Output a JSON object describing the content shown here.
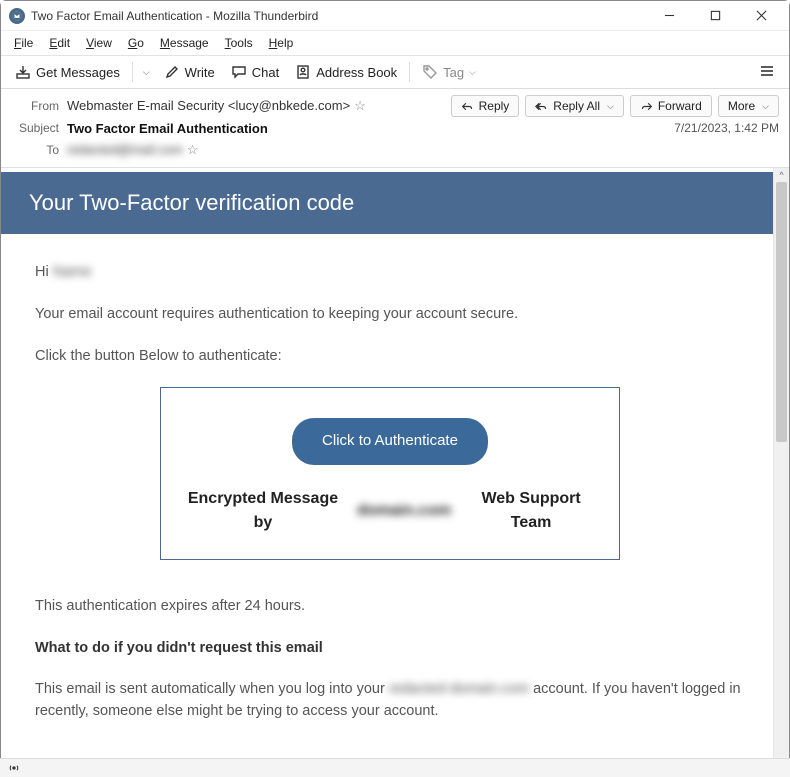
{
  "window": {
    "title": "Two Factor Email Authentication - Mozilla Thunderbird"
  },
  "menu": {
    "file": "File",
    "edit": "Edit",
    "view": "View",
    "go": "Go",
    "message": "Message",
    "tools": "Tools",
    "help": "Help"
  },
  "toolbar": {
    "get_messages": "Get Messages",
    "write": "Write",
    "chat": "Chat",
    "address_book": "Address Book",
    "tag": "Tag"
  },
  "header": {
    "from_label": "From",
    "from_value": "Webmaster E-mail Security <lucy@nbkede.com>",
    "subject_label": "Subject",
    "subject_value": "Two Factor Email Authentication",
    "to_label": "To",
    "to_value": "redacted@mail.com",
    "date": "7/21/2023, 1:42 PM",
    "reply": "Reply",
    "reply_all": "Reply All",
    "forward": "Forward",
    "more": "More"
  },
  "email": {
    "banner": "Your Two-Factor verification code",
    "greeting_prefix": "Hi ",
    "greeting_name": "Name",
    "line1": "Your email account requires authentication to keeping your account secure.",
    "line2": "Click the button Below to authenticate:",
    "auth_button": "Click to Authenticate",
    "encrypted_prefix": "Encrypted Message by",
    "encrypted_domain": "domain.com",
    "encrypted_suffix": "Web Support Team",
    "expires": "This authentication expires after 24 hours.",
    "not_request_title": "What to do if you didn't request this email",
    "not_request_body_1": "This email is sent automatically when you log into your ",
    "not_request_domain": "redacted-domain.com",
    "not_request_body_2": " account. If you haven't logged in recently, someone else might be trying to access your account."
  }
}
